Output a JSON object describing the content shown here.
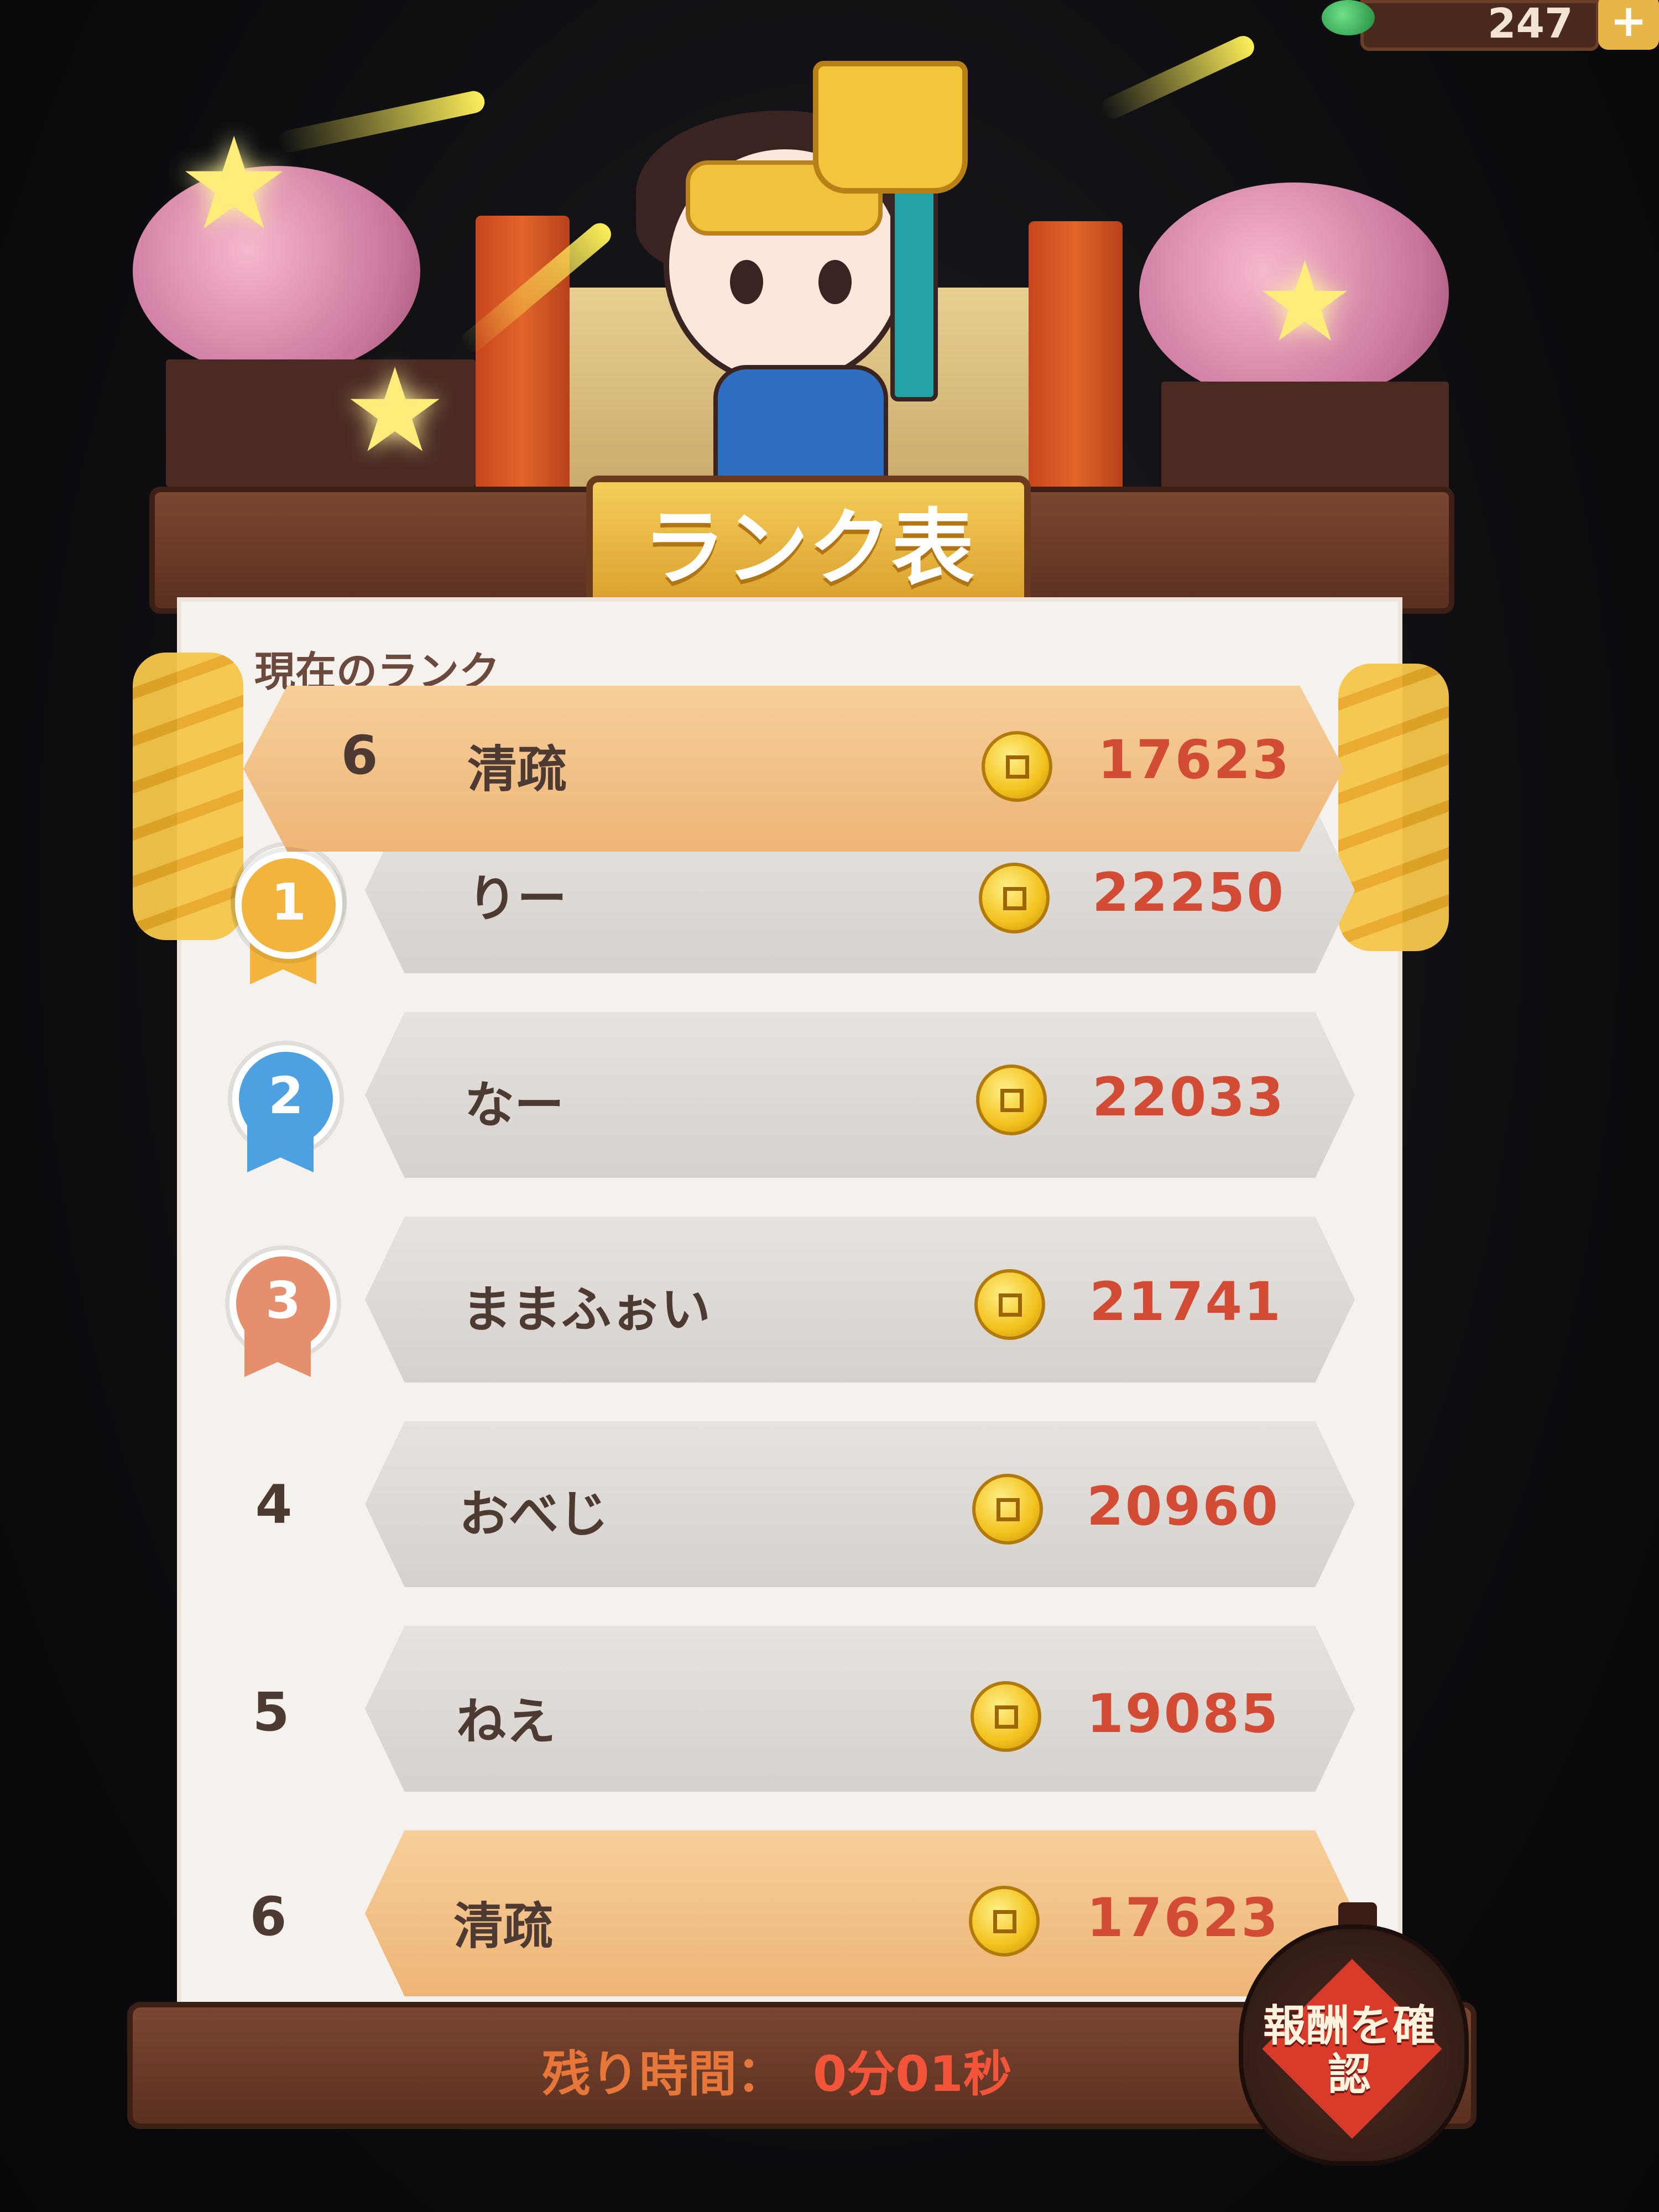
{
  "currency": {
    "value": "247",
    "plus_label": "+"
  },
  "title": "ランク表",
  "current_rank": {
    "label": "現在のランク",
    "rank": "6",
    "name": "清疏",
    "score": "17623"
  },
  "leaderboard": [
    {
      "rank": "1",
      "name": "りー",
      "score": "22250",
      "medal": "gold"
    },
    {
      "rank": "2",
      "name": "なー",
      "score": "22033",
      "medal": "silver"
    },
    {
      "rank": "3",
      "name": "ままふぉい",
      "score": "21741",
      "medal": "bronze"
    },
    {
      "rank": "4",
      "name": "おべじ",
      "score": "20960"
    },
    {
      "rank": "5",
      "name": "ねえ",
      "score": "19085"
    },
    {
      "rank": "6",
      "name": "清疏",
      "score": "17623",
      "highlight": true
    }
  ],
  "footer": {
    "timer_label": "残り時間：",
    "timer_value": "0分01秒",
    "reward_button_label": "報酬を確認"
  },
  "colors": {
    "highlight_row": "#eeb576",
    "score_text": "#d24b35",
    "gold_medal": "#f2b43c",
    "silver_medal": "#4ea1e0",
    "bronze_medal": "#e58f6d"
  },
  "icons": [
    "coin-icon",
    "gem-icon",
    "medal-icon",
    "star-icon"
  ]
}
